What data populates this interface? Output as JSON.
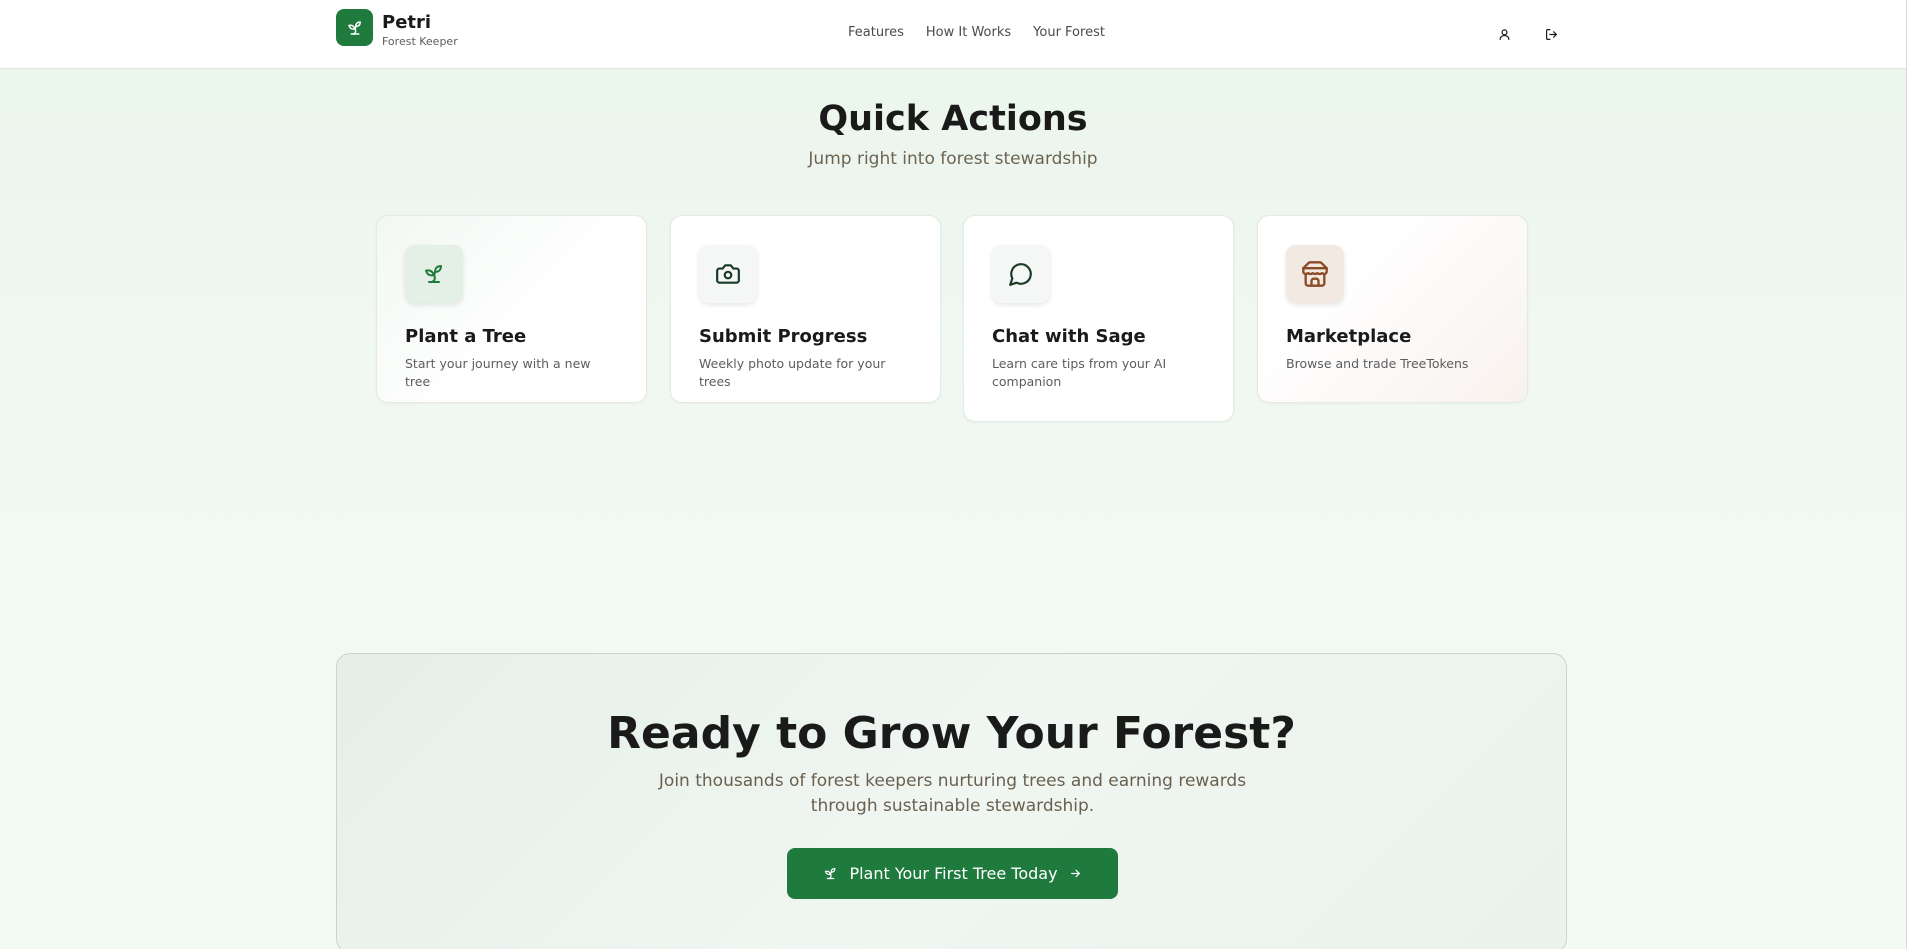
{
  "header": {
    "brand_name": "Petri",
    "brand_tagline": "Forest Keeper",
    "nav": [
      "Features",
      "How It Works",
      "Your Forest"
    ],
    "icons": [
      "user-icon",
      "logout-icon"
    ]
  },
  "quick_actions": {
    "title": "Quick Actions",
    "subtitle": "Jump right into forest stewardship",
    "cards": [
      {
        "title": "Plant a Tree",
        "description": "Start your journey with a new tree",
        "icon": "sprout-icon"
      },
      {
        "title": "Submit Progress",
        "description": "Weekly photo update for your trees",
        "icon": "camera-icon"
      },
      {
        "title": "Chat with Sage",
        "description": "Learn care tips from your AI companion",
        "icon": "chat-bubble-icon"
      },
      {
        "title": "Marketplace",
        "description": "Browse and trade TreeTokens",
        "icon": "store-icon"
      }
    ]
  },
  "cta": {
    "title": "Ready to Grow Your Forest?",
    "subtitle": "Join thousands of forest keepers nurturing trees and earning rewards through sustainable stewardship.",
    "button_label": "Plant Your First Tree Today"
  },
  "colors": {
    "primary_green": "#1f7a3d",
    "brown_accent": "#8a4a26",
    "muted_text": "#6e6452"
  }
}
